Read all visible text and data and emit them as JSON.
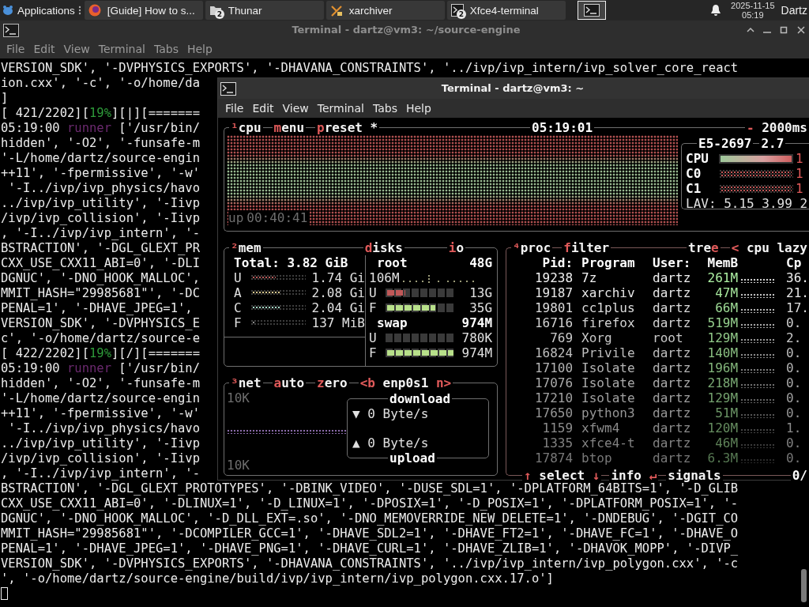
{
  "taskbar": {
    "menu_label": "Applications",
    "tasks": [
      {
        "label": "[Guide] How to s...",
        "kind": "browser"
      },
      {
        "label": "Thunar",
        "kind": "folder",
        "badge": "2"
      },
      {
        "label": "xarchiver",
        "kind": "archive"
      },
      {
        "label": "Xfce4-terminal",
        "kind": "terminal",
        "badge": "2"
      }
    ],
    "clock": {
      "date": "2025-11-15",
      "time": "05:19"
    },
    "user": "Dartz"
  },
  "back_window": {
    "title": "Terminal - dartz@vm3: ~/source-engine",
    "menu": [
      "File",
      "Edit",
      "View",
      "Terminal",
      "Tabs",
      "Help"
    ],
    "lines": [
      {
        "kind": "text",
        "text": "VERSION_SDK', '-DVPHYSICS_EXPORTS', '-DHAVANA_CONSTRAINTS', '../ivp/ivp_intern/ivp_solver_core_react"
      },
      {
        "kind": "text",
        "text": "ion.cxx', '-c', '-o/home/da"
      },
      {
        "kind": "text",
        "text": "]"
      },
      {
        "kind": "rich",
        "segments": [
          {
            "text": "[ 421/2202][",
            "kind": "plain"
          },
          {
            "text": "19%",
            "kind": "percent"
          },
          {
            "text": "][|][=======",
            "kind": "plain"
          }
        ]
      },
      {
        "kind": "rich",
        "segments": [
          {
            "text": "05:19:00 ",
            "kind": "plain"
          },
          {
            "text": "runner",
            "kind": "tag"
          },
          {
            "text": " ['/usr/bin/",
            "kind": "plain"
          }
        ]
      },
      {
        "kind": "text",
        "text": "hidden', '-O2', '-funsafe-m"
      },
      {
        "kind": "text",
        "text": "'-L/home/dartz/source-engin"
      },
      {
        "kind": "text",
        "text": "++11', '-fpermissive', '-w'"
      },
      {
        "kind": "text",
        "text": " '-I../ivp/ivp_physics/havo"
      },
      {
        "kind": "text",
        "text": "../ivp/ivp_utility', '-Iivp"
      },
      {
        "kind": "text",
        "text": "/ivp/ivp_collision', '-Iivp"
      },
      {
        "kind": "text",
        "text": ", '-I../ivp/ivp_intern', '-"
      },
      {
        "kind": "text",
        "text": "BSTRACTION', '-DGL_GLEXT_PR"
      },
      {
        "kind": "text",
        "text": "CXX_USE_CXX11_ABI=0', '-DLI"
      },
      {
        "kind": "text",
        "text": "DGNUC', '-DNO_HOOK_MALLOC',"
      },
      {
        "kind": "text",
        "text": "MMIT_HASH=\"29985681\"', '-DC"
      },
      {
        "kind": "text",
        "text": "PENAL=1', '-DHAVE_JPEG=1',"
      },
      {
        "kind": "text",
        "text": "VERSION_SDK', '-DVPHYSICS_E"
      },
      {
        "kind": "text",
        "text": "c', '-o/home/dartz/source-e"
      },
      {
        "kind": "rich",
        "segments": [
          {
            "text": "[ 422/2202][",
            "kind": "plain"
          },
          {
            "text": "19%",
            "kind": "percent"
          },
          {
            "text": "][/][=======",
            "kind": "plain"
          }
        ]
      },
      {
        "kind": "rich",
        "segments": [
          {
            "text": "05:19:00 ",
            "kind": "plain"
          },
          {
            "text": "runner",
            "kind": "tag"
          },
          {
            "text": " ['/usr/bin/",
            "kind": "plain"
          }
        ]
      },
      {
        "kind": "text",
        "text": "hidden', '-O2', '-funsafe-m"
      },
      {
        "kind": "text",
        "text": "'-L/home/dartz/source-engin"
      },
      {
        "kind": "text",
        "text": "++11', '-fpermissive', '-w'"
      },
      {
        "kind": "text",
        "text": " '-I../ivp/ivp_physics/havo"
      },
      {
        "kind": "text",
        "text": "../ivp/ivp_utility', '-Iivp"
      },
      {
        "kind": "text",
        "text": "/ivp/ivp_collision', '-Iivp"
      },
      {
        "kind": "text",
        "text": ", '-I../ivp/ivp_intern', '-"
      },
      {
        "kind": "text",
        "text": "BSTRACTION', '-DGL_GLEXT_PROTOTYPES', '-DBINK_VIDEO', '-DUSE_SDL=1', '-DPLATFORM_64BITS=1', '-D_GLIB"
      },
      {
        "kind": "text",
        "text": "CXX_USE_CXX11_ABI=0', '-DLINUX=1', '-D_LINUX=1', '-DPOSIX=1', '-D_POSIX=1', '-DPLATFORM_POSIX=1', '-"
      },
      {
        "kind": "text",
        "text": "DGNUC', '-DNO_HOOK_MALLOC', '-D_DLL_EXT=.so', '-DNO_MEMOVERRIDE_NEW_DELETE=1', '-DNDEBUG', '-DGIT_CO"
      },
      {
        "kind": "text",
        "text": "MMIT_HASH=\"29985681\"', '-DCOMPILER_GCC=1', '-DHAVE_SDL2=1', '-DHAVE_FT2=1', '-DHAVE_FC=1', '-DHAVE_O"
      },
      {
        "kind": "text",
        "text": "PENAL=1', '-DHAVE_JPEG=1', '-DHAVE_PNG=1', '-DHAVE_CURL=1', '-DHAVE_ZLIB=1', '-DHAVOK_MOPP', '-DIVP_"
      },
      {
        "kind": "text",
        "text": "VERSION_SDK', '-DVPHYSICS_EXPORTS', '-DHAVANA_CONSTRAINTS', '../ivp/ivp_intern/ivp_polygon.cxx', '-c"
      },
      {
        "kind": "text",
        "text": "', '-o/home/dartz/source-engine/build/ivp/ivp_intern/ivp_polygon.cxx.17.o']"
      },
      {
        "kind": "cursor"
      }
    ]
  },
  "front_window": {
    "title": "Terminal - dartz@vm3: ~",
    "menu": [
      "File",
      "Edit",
      "View",
      "Terminal",
      "Tabs",
      "Help"
    ],
    "btop": {
      "cpu_box": {
        "header_left": [
          {
            "parts": [
              {
                "text": "¹",
                "hot": true
              },
              {
                "text": "cpu",
                "hot": false
              }
            ]
          },
          {
            "parts": [
              {
                "text": "m",
                "hot": true
              },
              {
                "text": "enu",
                "hot": false
              }
            ]
          },
          {
            "parts": [
              {
                "text": "p",
                "hot": true
              },
              {
                "text": "reset *",
                "hot": false
              }
            ]
          }
        ],
        "clock": "05:19:01",
        "header_right": [
          {
            "parts": [
              {
                "text": "-",
                "hot": true
              },
              {
                "text": " 2000ms",
                "hot": false
              }
            ]
          }
        ],
        "uptime": {
          "label": "up",
          "value": "00:40:41"
        },
        "model": "E5-2697",
        "freq": "2.7",
        "bars": [
          {
            "label": "CPU",
            "kind": "gradient",
            "level": 1,
            "value": "1"
          },
          {
            "label": "C0",
            "kind": "solid",
            "level": 1,
            "value": "1"
          },
          {
            "label": "C1",
            "kind": "solid",
            "level": 1,
            "value": "1"
          }
        ],
        "load": "LAV: 5.15 3.99 2"
      },
      "mem_box": {
        "header": [
          {
            "parts": [
              {
                "text": "²",
                "hot": true
              },
              {
                "text": "mem",
                "hot": false
              }
            ]
          }
        ],
        "disks_header": [
          {
            "parts": [
              {
                "text": "d",
                "hot": true
              },
              {
                "text": "isks",
                "hot": false
              }
            ]
          },
          {
            "parts": [
              {
                "text": "i",
                "hot": true
              },
              {
                "text": "o",
                "hot": false
              }
            ]
          }
        ],
        "total": "Total: 3.82 GiB",
        "meters": [
          {
            "label": "U",
            "level": 0.46,
            "value": "1.74 Gi",
            "color": "#b85c5c"
          },
          {
            "label": "A",
            "level": 0.54,
            "value": "2.08 Gi",
            "color": "#d8c890"
          },
          {
            "label": "C",
            "level": 0.53,
            "value": "2.04 Gi",
            "color": "#a8d8c8"
          },
          {
            "label": "F",
            "level": 0.04,
            "value": "137 MiB",
            "color": "#8a8a8a"
          }
        ],
        "disks": [
          {
            "name": "root",
            "size": "48G",
            "io": "106M",
            "rows": [
              {
                "label": "U",
                "level": 0.27,
                "value": "13G",
                "color": "#c05858"
              },
              {
                "label": "F",
                "level": 0.73,
                "value": "35G",
                "color": "#b8e08a"
              }
            ]
          },
          {
            "name": "swap",
            "size": "974M",
            "rows": [
              {
                "label": "U",
                "value": "780K"
              },
              {
                "label": "F",
                "level": 1,
                "value": "974M",
                "color": "#b8e08a"
              }
            ]
          }
        ]
      },
      "net_box": {
        "header": [
          {
            "parts": [
              {
                "text": "³",
                "hot": true
              },
              {
                "text": "net",
                "hot": false
              }
            ]
          },
          {
            "parts": [
              {
                "text": "a",
                "hot": true
              },
              {
                "text": "uto",
                "hot": false
              }
            ]
          },
          {
            "parts": [
              {
                "text": "z",
                "hot": true
              },
              {
                "text": "ero",
                "hot": false
              }
            ]
          },
          {
            "parts": [
              {
                "text": "<b",
                "hot": true
              },
              {
                "text": " enp0s1 ",
                "hot": false
              },
              {
                "text": "n>",
                "hot": true
              }
            ]
          }
        ],
        "scale_top": "10K",
        "scale_bottom": "10K",
        "download": {
          "label": "download",
          "arrow": "▼",
          "rate": "0 Byte/s"
        },
        "upload": {
          "label": "upload",
          "arrow": "▲",
          "rate": "0 Byte/s"
        }
      },
      "proc_box": {
        "header": [
          {
            "parts": [
              {
                "text": "⁴",
                "hot": true
              },
              {
                "text": "proc",
                "hot": false
              }
            ]
          },
          {
            "parts": [
              {
                "text": "f",
                "hot": true
              },
              {
                "text": "ilter",
                "hot": false
              }
            ]
          }
        ],
        "header_right": [
          {
            "parts": [
              {
                "text": "tre",
                "hot": false
              },
              {
                "text": "e",
                "hot": true
              }
            ]
          },
          {
            "parts": [
              {
                "text": "<",
                "hot": true
              },
              {
                "text": " cpu lazy",
                "hot": false
              }
            ]
          }
        ],
        "columns": [
          "Pid:",
          "Program",
          "User:",
          "MemB",
          "Cp"
        ],
        "rows": [
          {
            "pid": "19238",
            "program": "7z",
            "user": "dartz",
            "mem": "261M",
            "cpu": "36."
          },
          {
            "pid": "19187",
            "program": "xarchiv",
            "user": "dartz",
            "mem": "47M",
            "cpu": "21."
          },
          {
            "pid": "19801",
            "program": "cc1plus",
            "user": "dartz",
            "mem": "66M",
            "cpu": "17."
          },
          {
            "pid": "16716",
            "program": "firefox",
            "user": "dartz",
            "mem": "519M",
            "cpu": "0."
          },
          {
            "pid": "769",
            "program": "Xorg",
            "user": "root",
            "mem": "129M",
            "cpu": "2."
          },
          {
            "pid": "16824",
            "program": "Privile",
            "user": "dartz",
            "mem": "140M",
            "cpu": "0."
          },
          {
            "pid": "17100",
            "program": "Isolate",
            "user": "dartz",
            "mem": "196M",
            "cpu": "0."
          },
          {
            "pid": "17076",
            "program": "Isolate",
            "user": "dartz",
            "mem": "218M",
            "cpu": "0."
          },
          {
            "pid": "17210",
            "program": "Isolate",
            "user": "dartz",
            "mem": "129M",
            "cpu": "0."
          },
          {
            "pid": "17650",
            "program": "python3",
            "user": "dartz",
            "mem": "51M",
            "cpu": "0."
          },
          {
            "pid": "1159",
            "program": "xfwm4",
            "user": "dartz",
            "mem": "120M",
            "cpu": "1."
          },
          {
            "pid": "1335",
            "program": "xfce4-t",
            "user": "dartz",
            "mem": "46M",
            "cpu": "0."
          },
          {
            "pid": "17874",
            "program": "btop",
            "user": "dartz",
            "mem": "6.3M",
            "cpu": "0."
          }
        ],
        "footer": [
          {
            "parts": [
              {
                "text": "↑",
                "hot": true
              },
              {
                "text": " select ",
                "hot": false
              },
              {
                "text": "↓",
                "hot": true
              }
            ]
          },
          {
            "parts": [
              {
                "text": "info ",
                "hot": false
              },
              {
                "text": "↵",
                "hot": true
              }
            ]
          },
          {
            "parts": [
              {
                "text": "signals",
                "hot": false
              }
            ]
          }
        ],
        "footer_right": "0/"
      }
    }
  }
}
